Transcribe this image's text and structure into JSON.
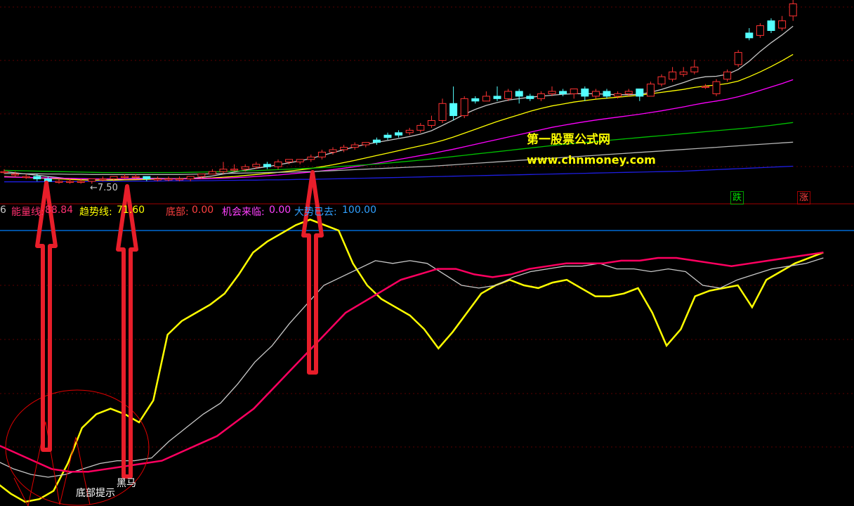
{
  "legend": {
    "index_prefix": "6",
    "energy_label": "能量线:",
    "energy_value": "88.84",
    "trend_label": "趋势线:",
    "trend_value": "71.60",
    "bottom_label": "底部:",
    "bottom_value": "0.00",
    "chance_label": "机会来临:",
    "chance_value": "0.00",
    "gone_label": "大势已去:",
    "gone_value": "100.00"
  },
  "tags": {
    "fall": "跌",
    "rise": "涨"
  },
  "watermark": {
    "line1": "第一股票公式网",
    "line2": "www.chnmoney.com"
  },
  "price_label": "←7.50",
  "annotations": {
    "bottom_hint": "底部提示",
    "dark_horse": "黑马"
  },
  "colors": {
    "bg": "#000000",
    "up": "#ff3232",
    "down": "#54ffff",
    "yellow": "#ffff00",
    "magenta": "#ff0080",
    "white": "#c8c8c8",
    "arrow": "#e81e2a",
    "divider": "#a00000",
    "blue_line": "#0080ff"
  },
  "chart_data": [
    {
      "type": "candlestick",
      "panel": "price",
      "price_marker": 7.5,
      "candles": [
        {
          "o": 7.9,
          "c": 7.9,
          "h": 8.0,
          "l": 7.8
        },
        {
          "o": 7.8,
          "c": 7.8,
          "h": 7.9,
          "l": 7.7
        },
        {
          "o": 7.7,
          "c": 7.7,
          "h": 7.8,
          "l": 7.6
        },
        {
          "o": 7.7,
          "c": 7.6,
          "h": 7.8,
          "l": 7.5
        },
        {
          "o": 7.6,
          "c": 7.5,
          "h": 7.7,
          "l": 7.4
        },
        {
          "o": 7.5,
          "c": 7.5,
          "h": 7.6,
          "l": 7.4
        },
        {
          "o": 7.5,
          "c": 7.5,
          "h": 7.6,
          "l": 7.4
        },
        {
          "o": 7.5,
          "c": 7.5,
          "h": 7.6,
          "l": 7.4
        },
        {
          "o": 7.5,
          "c": 7.6,
          "h": 7.6,
          "l": 7.4
        },
        {
          "o": 7.6,
          "c": 7.6,
          "h": 7.7,
          "l": 7.5
        },
        {
          "o": 7.6,
          "c": 7.7,
          "h": 7.7,
          "l": 7.5
        },
        {
          "o": 7.7,
          "c": 7.7,
          "h": 7.8,
          "l": 7.6
        },
        {
          "o": 7.7,
          "c": 7.7,
          "h": 7.8,
          "l": 7.6
        },
        {
          "o": 7.7,
          "c": 7.6,
          "h": 7.7,
          "l": 7.5
        },
        {
          "o": 7.6,
          "c": 7.6,
          "h": 7.7,
          "l": 7.5
        },
        {
          "o": 7.6,
          "c": 7.6,
          "h": 7.7,
          "l": 7.5
        },
        {
          "o": 7.6,
          "c": 7.6,
          "h": 7.7,
          "l": 7.5
        },
        {
          "o": 7.6,
          "c": 7.7,
          "h": 7.7,
          "l": 7.5
        },
        {
          "o": 7.7,
          "c": 7.8,
          "h": 7.8,
          "l": 7.6
        },
        {
          "o": 7.8,
          "c": 7.9,
          "h": 8.0,
          "l": 7.8
        },
        {
          "o": 7.9,
          "c": 8.0,
          "h": 8.3,
          "l": 7.8
        },
        {
          "o": 8.0,
          "c": 8.0,
          "h": 8.2,
          "l": 7.9
        },
        {
          "o": 8.0,
          "c": 8.1,
          "h": 8.2,
          "l": 7.9
        },
        {
          "o": 8.1,
          "c": 8.2,
          "h": 8.3,
          "l": 8.0
        },
        {
          "o": 8.2,
          "c": 8.1,
          "h": 8.3,
          "l": 8.0
        },
        {
          "o": 8.1,
          "c": 8.3,
          "h": 8.4,
          "l": 8.0
        },
        {
          "o": 8.3,
          "c": 8.4,
          "h": 8.4,
          "l": 8.2
        },
        {
          "o": 8.3,
          "c": 8.4,
          "h": 8.4,
          "l": 8.2
        },
        {
          "o": 8.4,
          "c": 8.5,
          "h": 8.6,
          "l": 8.3
        },
        {
          "o": 8.5,
          "c": 8.7,
          "h": 8.8,
          "l": 8.4
        },
        {
          "o": 8.7,
          "c": 8.8,
          "h": 8.9,
          "l": 8.6
        },
        {
          "o": 8.8,
          "c": 8.9,
          "h": 9.0,
          "l": 8.7
        },
        {
          "o": 8.9,
          "c": 9.0,
          "h": 9.1,
          "l": 8.8
        },
        {
          "o": 9.0,
          "c": 9.1,
          "h": 9.1,
          "l": 8.9
        },
        {
          "o": 9.2,
          "c": 9.1,
          "h": 9.3,
          "l": 9.0
        },
        {
          "o": 9.4,
          "c": 9.3,
          "h": 9.5,
          "l": 9.2
        },
        {
          "o": 9.5,
          "c": 9.4,
          "h": 9.6,
          "l": 9.3
        },
        {
          "o": 9.5,
          "c": 9.6,
          "h": 9.7,
          "l": 9.4
        },
        {
          "o": 9.6,
          "c": 9.8,
          "h": 9.9,
          "l": 9.5
        },
        {
          "o": 9.8,
          "c": 10.0,
          "h": 10.2,
          "l": 9.7
        },
        {
          "o": 10.0,
          "c": 10.7,
          "h": 10.9,
          "l": 9.9
        },
        {
          "o": 10.7,
          "c": 10.2,
          "h": 11.4,
          "l": 10.0
        },
        {
          "o": 10.2,
          "c": 10.9,
          "h": 11.0,
          "l": 10.1
        },
        {
          "o": 10.9,
          "c": 10.8,
          "h": 11.0,
          "l": 10.7
        },
        {
          "o": 10.8,
          "c": 11.0,
          "h": 11.2,
          "l": 10.8
        },
        {
          "o": 11.0,
          "c": 10.9,
          "h": 11.4,
          "l": 10.8
        },
        {
          "o": 10.9,
          "c": 11.2,
          "h": 11.3,
          "l": 10.8
        },
        {
          "o": 11.2,
          "c": 11.0,
          "h": 11.3,
          "l": 10.7
        },
        {
          "o": 11.0,
          "c": 10.9,
          "h": 11.1,
          "l": 10.8
        },
        {
          "o": 10.9,
          "c": 11.1,
          "h": 11.2,
          "l": 10.8
        },
        {
          "o": 11.1,
          "c": 11.2,
          "h": 11.4,
          "l": 11.0
        },
        {
          "o": 11.2,
          "c": 11.1,
          "h": 11.3,
          "l": 11.0
        },
        {
          "o": 11.1,
          "c": 11.3,
          "h": 11.3,
          "l": 10.9
        },
        {
          "o": 11.3,
          "c": 11.0,
          "h": 11.4,
          "l": 10.8
        },
        {
          "o": 11.0,
          "c": 11.2,
          "h": 11.3,
          "l": 10.9
        },
        {
          "o": 11.2,
          "c": 11.0,
          "h": 11.3,
          "l": 10.9
        },
        {
          "o": 11.0,
          "c": 11.1,
          "h": 11.2,
          "l": 10.9
        },
        {
          "o": 11.1,
          "c": 11.2,
          "h": 11.3,
          "l": 11.0
        },
        {
          "o": 11.3,
          "c": 11.0,
          "h": 11.3,
          "l": 10.8
        },
        {
          "o": 11.0,
          "c": 11.5,
          "h": 11.6,
          "l": 11.0
        },
        {
          "o": 11.5,
          "c": 11.8,
          "h": 11.9,
          "l": 11.4
        },
        {
          "o": 11.7,
          "c": 12.0,
          "h": 12.2,
          "l": 11.6
        },
        {
          "o": 11.9,
          "c": 12.0,
          "h": 12.2,
          "l": 11.8
        },
        {
          "o": 12.0,
          "c": 12.2,
          "h": 12.5,
          "l": 11.9
        },
        {
          "o": 11.4,
          "c": 11.4,
          "h": 11.5,
          "l": 11.3
        },
        {
          "o": 11.1,
          "c": 11.6,
          "h": 11.7,
          "l": 11.0
        },
        {
          "o": 11.7,
          "c": 12.0,
          "h": 12.1,
          "l": 11.6
        },
        {
          "o": 12.3,
          "c": 12.8,
          "h": 12.9,
          "l": 12.2
        },
        {
          "o": 13.6,
          "c": 13.4,
          "h": 13.8,
          "l": 13.3
        },
        {
          "o": 13.5,
          "c": 13.9,
          "h": 14.0,
          "l": 13.4
        },
        {
          "o": 14.1,
          "c": 13.7,
          "h": 14.2,
          "l": 13.6
        },
        {
          "o": 13.8,
          "c": 14.1,
          "h": 14.3,
          "l": 13.7
        },
        {
          "o": 14.3,
          "c": 14.8,
          "h": 15.0,
          "l": 14.1
        }
      ],
      "moving_averages": [
        {
          "color": "#c8c8c8",
          "values": [
            7.9,
            7.85,
            7.8,
            7.75,
            7.7,
            7.65,
            7.6,
            7.57,
            7.55,
            7.55,
            7.57,
            7.6,
            7.62,
            7.62,
            7.62,
            7.61,
            7.61,
            7.62,
            7.66,
            7.72,
            7.8,
            7.88,
            7.96,
            8.04,
            8.1,
            8.18,
            8.26,
            8.34,
            8.44,
            8.56,
            8.68,
            8.8,
            8.92,
            9.02,
            9.1,
            9.18,
            9.26,
            9.34,
            9.44,
            9.58,
            9.8,
            10.02,
            10.26,
            10.46,
            10.62,
            10.74,
            10.84,
            10.9,
            10.96,
            11.0,
            11.04,
            11.08,
            11.1,
            11.1,
            11.1,
            11.08,
            11.06,
            11.06,
            11.08,
            11.16,
            11.28,
            11.42,
            11.56,
            11.72,
            11.8,
            11.82,
            11.9,
            12.1,
            12.44,
            12.84,
            13.2,
            13.52,
            13.88
          ]
        },
        {
          "color": "#ffff00",
          "values": [
            7.7,
            7.68,
            7.66,
            7.64,
            7.62,
            7.6,
            7.58,
            7.56,
            7.55,
            7.55,
            7.55,
            7.56,
            7.57,
            7.58,
            7.59,
            7.6,
            7.6,
            7.61,
            7.62,
            7.64,
            7.67,
            7.7,
            7.74,
            7.78,
            7.82,
            7.87,
            7.92,
            7.97,
            8.03,
            8.1,
            8.18,
            8.27,
            8.36,
            8.46,
            8.56,
            8.66,
            8.76,
            8.86,
            8.96,
            9.06,
            9.18,
            9.32,
            9.48,
            9.64,
            9.8,
            9.96,
            10.1,
            10.24,
            10.38,
            10.5,
            10.6,
            10.68,
            10.76,
            10.82,
            10.88,
            10.92,
            10.96,
            11.0,
            11.04,
            11.1,
            11.16,
            11.22,
            11.28,
            11.36,
            11.42,
            11.46,
            11.52,
            11.62,
            11.8,
            12.0,
            12.22,
            12.46,
            12.72
          ]
        },
        {
          "color": "#ff00ff",
          "values": [
            7.68,
            7.67,
            7.66,
            7.65,
            7.64,
            7.63,
            7.62,
            7.61,
            7.6,
            7.6,
            7.6,
            7.6,
            7.6,
            7.6,
            7.6,
            7.6,
            7.6,
            7.6,
            7.61,
            7.62,
            7.63,
            7.65,
            7.67,
            7.7,
            7.73,
            7.76,
            7.8,
            7.84,
            7.88,
            7.93,
            7.98,
            8.04,
            8.1,
            8.17,
            8.24,
            8.32,
            8.4,
            8.48,
            8.56,
            8.64,
            8.73,
            8.82,
            8.92,
            9.02,
            9.12,
            9.22,
            9.32,
            9.42,
            9.52,
            9.62,
            9.72,
            9.8,
            9.88,
            9.95,
            10.02,
            10.08,
            10.14,
            10.2,
            10.26,
            10.33,
            10.4,
            10.48,
            10.56,
            10.65,
            10.73,
            10.8,
            10.88,
            10.98,
            11.1,
            11.24,
            11.38,
            11.52,
            11.68
          ]
        },
        {
          "color": "#00c000",
          "values": [
            7.95,
            7.94,
            7.93,
            7.92,
            7.91,
            7.9,
            7.89,
            7.88,
            7.87,
            7.86,
            7.86,
            7.86,
            7.86,
            7.86,
            7.86,
            7.86,
            7.86,
            7.87,
            7.88,
            7.89,
            7.9,
            7.92,
            7.93,
            7.94,
            7.96,
            7.98,
            8.0,
            8.02,
            8.04,
            8.06,
            8.09,
            8.12,
            8.15,
            8.18,
            8.21,
            8.25,
            8.29,
            8.33,
            8.37,
            8.42,
            8.47,
            8.52,
            8.57,
            8.62,
            8.67,
            8.72,
            8.77,
            8.82,
            8.87,
            8.92,
            8.97,
            9.02,
            9.06,
            9.1,
            9.14,
            9.18,
            9.22,
            9.26,
            9.3,
            9.34,
            9.38,
            9.42,
            9.46,
            9.5,
            9.54,
            9.58,
            9.62,
            9.66,
            9.7,
            9.75,
            9.8,
            9.86,
            9.92
          ]
        },
        {
          "color": "#b4b4b4",
          "values": [
            7.82,
            7.82,
            7.81,
            7.81,
            7.8,
            7.8,
            7.79,
            7.79,
            7.78,
            7.78,
            7.78,
            7.78,
            7.78,
            7.78,
            7.78,
            7.78,
            7.78,
            7.79,
            7.8,
            7.81,
            7.82,
            7.83,
            7.84,
            7.85,
            7.86,
            7.87,
            7.88,
            7.89,
            7.9,
            7.92,
            7.94,
            7.96,
            7.98,
            8.0,
            8.02,
            8.04,
            8.06,
            8.08,
            8.1,
            8.12,
            8.15,
            8.18,
            8.21,
            8.24,
            8.27,
            8.3,
            8.33,
            8.36,
            8.39,
            8.42,
            8.45,
            8.48,
            8.51,
            8.54,
            8.57,
            8.6,
            8.63,
            8.66,
            8.69,
            8.72,
            8.75,
            8.78,
            8.81,
            8.84,
            8.87,
            8.9,
            8.93,
            8.96,
            8.99,
            9.02,
            9.05,
            9.08,
            9.11
          ]
        },
        {
          "color": "#1e1ee0",
          "values": [
            7.48,
            7.48,
            7.48,
            7.48,
            7.49,
            7.49,
            7.49,
            7.49,
            7.5,
            7.5,
            7.5,
            7.5,
            7.51,
            7.51,
            7.51,
            7.52,
            7.52,
            7.52,
            7.53,
            7.53,
            7.54,
            7.54,
            7.55,
            7.55,
            7.56,
            7.56,
            7.57,
            7.58,
            7.58,
            7.59,
            7.6,
            7.61,
            7.62,
            7.63,
            7.64,
            7.65,
            7.66,
            7.67,
            7.68,
            7.69,
            7.7,
            7.71,
            7.72,
            7.73,
            7.74,
            7.75,
            7.76,
            7.77,
            7.78,
            7.79,
            7.8,
            7.81,
            7.82,
            7.83,
            7.84,
            7.85,
            7.86,
            7.87,
            7.88,
            7.89,
            7.9,
            7.91,
            7.92,
            7.94,
            7.96,
            7.98,
            8.0,
            8.02,
            8.04,
            8.06,
            8.08,
            8.1,
            8.12
          ]
        }
      ]
    },
    {
      "type": "line",
      "panel": "indicator",
      "ylim": [
        0,
        100
      ],
      "reference_line": 100,
      "series": [
        {
          "color": "#ffff00",
          "values": [
            8,
            4,
            1,
            2,
            5,
            15,
            28,
            33,
            35,
            33,
            30,
            38,
            62,
            67,
            70,
            73,
            77,
            84,
            92,
            96,
            99,
            102,
            104,
            102,
            100,
            88,
            80,
            75,
            72,
            69,
            64,
            57,
            63,
            70,
            77,
            80,
            82,
            80,
            79,
            81,
            82,
            79,
            76,
            76,
            77,
            79,
            70,
            58,
            64,
            76,
            78,
            79,
            80,
            72,
            82,
            85,
            88,
            90,
            92
          ]
        },
        {
          "color": "#c8c8c8",
          "values": [
            16,
            13,
            11,
            10,
            11,
            13,
            15,
            16,
            16,
            17,
            23,
            28,
            33,
            37,
            44,
            52,
            58,
            66,
            73,
            80,
            83,
            86,
            89,
            88,
            89,
            88,
            84,
            80,
            79,
            80,
            83,
            85,
            86,
            87,
            87,
            88,
            86,
            86,
            85,
            86,
            85,
            80,
            79,
            82,
            84,
            86,
            87,
            88,
            90
          ]
        },
        {
          "color": "#ff0060",
          "values": [
            22,
            19,
            16,
            13,
            12,
            12,
            13,
            14,
            15,
            16,
            19,
            22,
            25,
            30,
            35,
            42,
            49,
            56,
            63,
            70,
            74,
            78,
            82,
            84,
            86,
            86,
            84,
            83,
            84,
            86,
            87,
            88,
            88,
            88,
            89,
            89,
            90,
            90,
            89,
            88,
            87,
            88,
            89,
            90,
            91,
            92
          ]
        }
      ]
    }
  ]
}
